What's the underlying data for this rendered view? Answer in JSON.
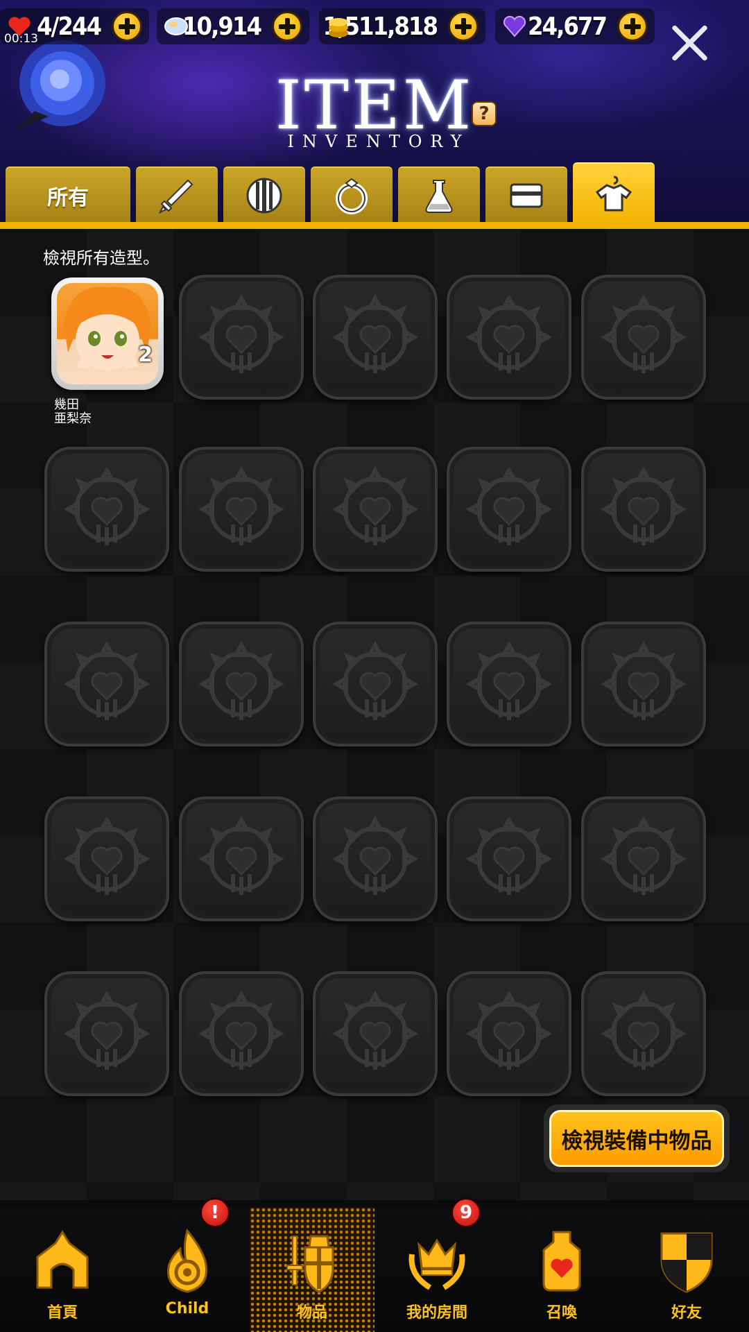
{
  "status": {
    "clock": "00:13",
    "stamina": "4/244",
    "gems": "10,914",
    "gold": "1,511,818",
    "crystals": "24,677"
  },
  "header": {
    "title": "ITEM",
    "subtitle": "INVENTORY",
    "help": "?"
  },
  "tabs": [
    {
      "label": "所有",
      "icon": "all-text"
    },
    {
      "label": "",
      "icon": "sword-icon"
    },
    {
      "label": "",
      "icon": "shield-icon"
    },
    {
      "label": "",
      "icon": "ring-icon"
    },
    {
      "label": "",
      "icon": "potion-icon"
    },
    {
      "label": "",
      "icon": "card-icon"
    },
    {
      "label": "",
      "icon": "costume-icon",
      "active": true
    }
  ],
  "content": {
    "hint": "檢視所有造型。",
    "items": [
      {
        "name": "幾田\n亜梨奈",
        "count": "2",
        "locked": false
      }
    ],
    "locked_slots": 24
  },
  "equip_button": "檢視裝備中物品",
  "nav": [
    {
      "label": "首頁",
      "icon": "home-icon",
      "badge": ""
    },
    {
      "label": "Child",
      "icon": "flame-icon",
      "badge": "!"
    },
    {
      "label": "物品",
      "icon": "items-icon",
      "badge": "",
      "active": true
    },
    {
      "label": "我的房間",
      "icon": "crown-icon",
      "badge": "9"
    },
    {
      "label": "召喚",
      "icon": "summon-jar-icon",
      "badge": ""
    },
    {
      "label": "好友",
      "icon": "friends-shield-icon",
      "badge": ""
    }
  ],
  "colors": {
    "accent": "#f2b400",
    "nav_label": "#ffc21a",
    "badge": "#d01a10"
  }
}
